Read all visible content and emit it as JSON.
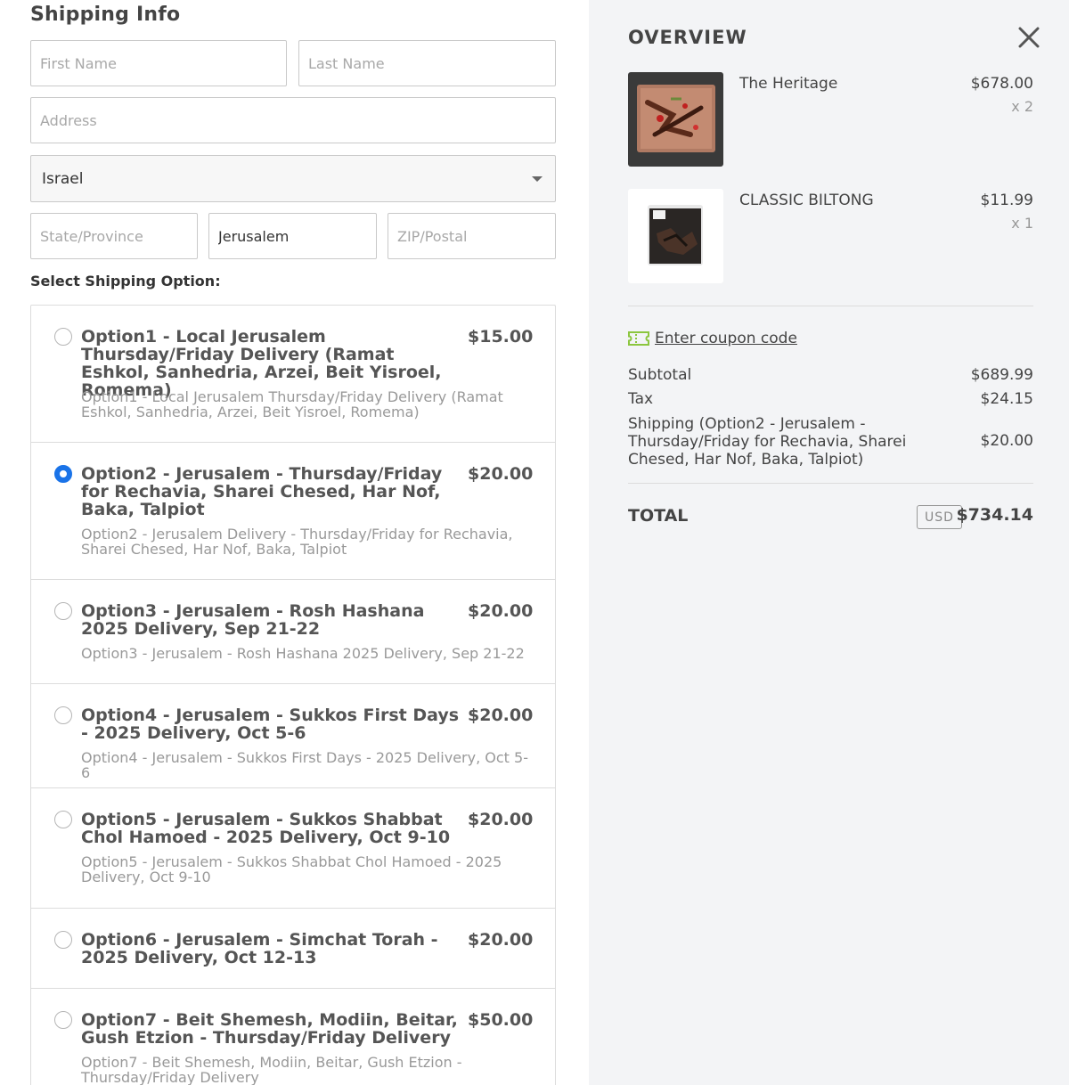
{
  "shipping": {
    "title": "Shipping Info",
    "first_name_placeholder": "First Name",
    "last_name_placeholder": "Last Name",
    "address_placeholder": "Address",
    "country": "Israel",
    "state_placeholder": "State/Province",
    "city_value": "Jerusalem",
    "zip_placeholder": "ZIP/Postal",
    "select_label": "Select Shipping Option:",
    "options": [
      {
        "title": "Option1 - Local Jerusalem Thursday/Friday Delivery (Ramat Eshkol, Sanhedria, Arzei, Beit Yisroel, Romema)",
        "price": "$15.00",
        "desc": "Option1 - Local Jerusalem Thursday/Friday Delivery (Ramat Eshkol, Sanhedria, Arzei, Beit Yisroel, Romema)",
        "selected": false
      },
      {
        "title": "Option2 - Jerusalem - Thursday/Friday for Rechavia, Sharei Chesed, Har Nof, Baka, Talpiot",
        "price": "$20.00",
        "desc": "Option2 - Jerusalem Delivery - Thursday/Friday for Rechavia, Sharei Chesed, Har Nof, Baka, Talpiot",
        "selected": true
      },
      {
        "title": "Option3 - Jerusalem - Rosh Hashana 2025 Delivery, Sep 21-22",
        "price": "$20.00",
        "desc": "Option3 - Jerusalem - Rosh Hashana 2025 Delivery, Sep 21-22",
        "selected": false
      },
      {
        "title": "Option4 - Jerusalem - Sukkos First Days - 2025 Delivery, Oct 5-6",
        "price": "$20.00",
        "desc": "Option4 - Jerusalem - Sukkos First Days - 2025 Delivery, Oct 5-6",
        "selected": false
      },
      {
        "title": "Option5 - Jerusalem - Sukkos Shabbat Chol Hamoed - 2025 Delivery, Oct 9-10",
        "price": "$20.00",
        "desc": "Option5 - Jerusalem - Sukkos Shabbat Chol Hamoed - 2025 Delivery, Oct 9-10",
        "selected": false
      },
      {
        "title": "Option6 - Jerusalem - Simchat Torah - 2025 Delivery, Oct 12-13",
        "price": "$20.00",
        "desc": "",
        "selected": false
      },
      {
        "title": "Option7 - Beit Shemesh, Modiin, Beitar, Gush Etzion - Thursday/Friday Delivery",
        "price": "$50.00",
        "desc": "Option7 - Beit Shemesh, Modiin, Beitar, Gush Etzion - Thursday/Friday Delivery",
        "selected": false
      }
    ]
  },
  "overview": {
    "title": "OVERVIEW",
    "items": [
      {
        "name": "The Heritage",
        "price": "$678.00",
        "qty": "x 2"
      },
      {
        "name": "CLASSIC BILTONG",
        "price": "$11.99",
        "qty": "x 1"
      }
    ],
    "coupon_label": "Enter coupon code",
    "subtotal_label": "Subtotal",
    "subtotal_value": "$689.99",
    "tax_label": "Tax",
    "tax_value": "$24.15",
    "shipping_label": "Shipping  (Option2 - Jerusalem - Thursday/Friday for Rechavia, Sharei Chesed, Har Nof, Baka, Talpiot)",
    "shipping_value": "$20.00",
    "total_label": "TOTAL",
    "currency": "USD",
    "total_value": "$734.14"
  },
  "colors": {
    "accent": "#1a73e8",
    "coupon_icon": "#8cc63f"
  },
  "icons": {
    "close": "close-icon",
    "coupon": "ticket-icon",
    "select": "chevron-down-icon"
  }
}
